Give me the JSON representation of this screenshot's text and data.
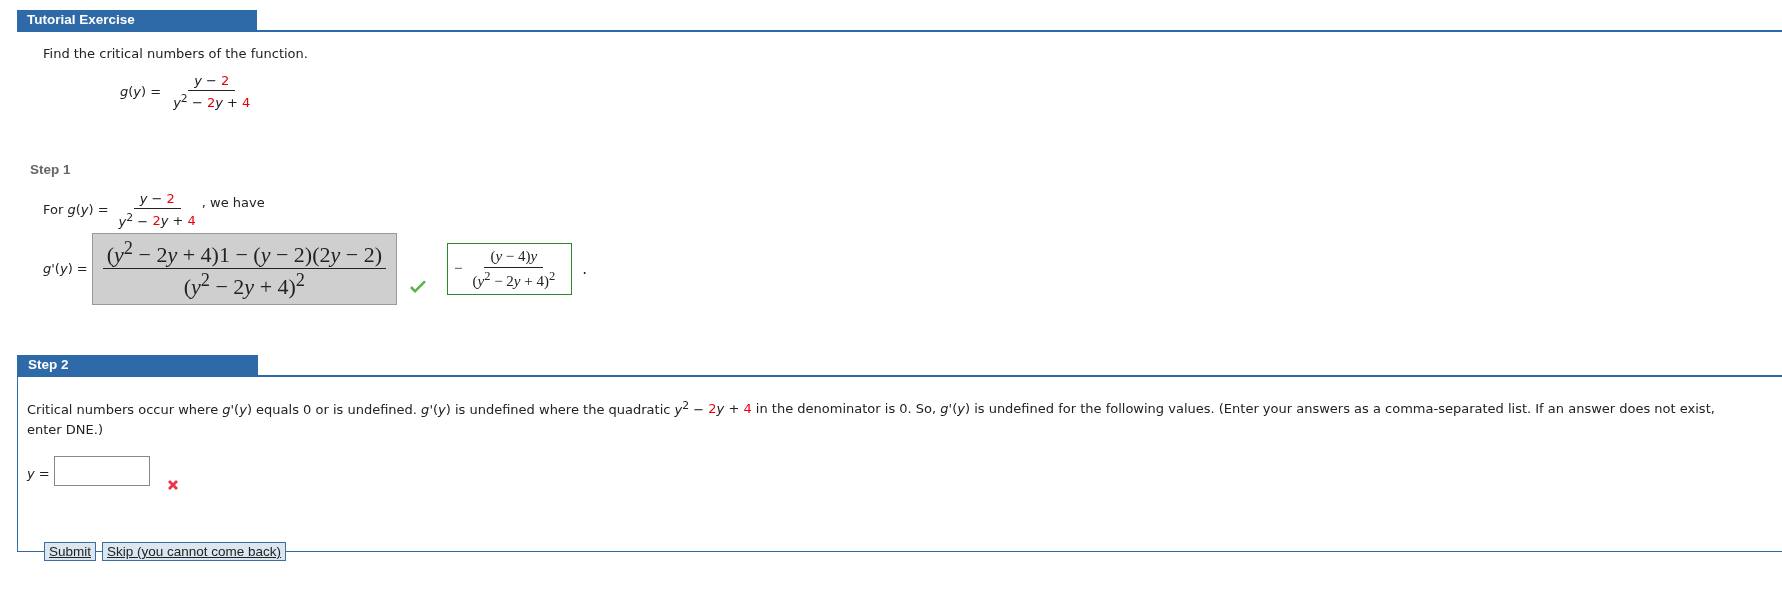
{
  "header": {
    "title": "Tutorial Exercise"
  },
  "problem": {
    "prompt": "Find the critical numbers of the function.",
    "function": {
      "lhs": "*g*(*y*) =",
      "numerator": [
        {
          "text": "*y* − ",
          "red": false
        },
        {
          "text": "2",
          "red": true
        }
      ],
      "denominator": [
        {
          "text": "*y*$^{2}$ − ",
          "red": false
        },
        {
          "text": "2",
          "red": true
        },
        {
          "text": "*y* + ",
          "red": false
        },
        {
          "text": "4",
          "red": true
        }
      ]
    }
  },
  "step1": {
    "label": "Step 1",
    "intro": {
      "before": "For *g*(*y*) =",
      "after": ", we have",
      "numerator": [
        {
          "text": "*y* − ",
          "red": false
        },
        {
          "text": "2",
          "red": true
        }
      ],
      "denominator": [
        {
          "text": "*y*$^{2}$ − ",
          "red": false
        },
        {
          "text": "2",
          "red": true
        },
        {
          "text": "*y* + ",
          "red": false
        },
        {
          "text": "4",
          "red": true
        }
      ]
    },
    "lhs": "*g*'(*y*) =",
    "answer": {
      "numerator": [
        "(*y*$^{2}$ − 2",
        "*y*",
        " + 4)1 − (*y* − 2)(2",
        "*y*",
        " − 2)"
      ],
      "denominator": [
        "(*y*$^{2}$ − 2",
        "*y*",
        " + 4)$^{2}$"
      ],
      "correct": true
    },
    "solution": {
      "sign": "−",
      "numerator": [
        "(*y* − 4)",
        "*y*"
      ],
      "denominator": [
        "(*y*$^{2}$ − 2",
        "*y*",
        " + 4)$^{2}$"
      ]
    },
    "end": "."
  },
  "step2": {
    "label": "Step 2",
    "text": [
      {
        "text": "Critical numbers occur where *g*'(*y*) equals 0 or is undefined. *g*'(*y*) is undefined where the quadratic *y*$^{2}$ − ",
        "red": false
      },
      {
        "text": "2",
        "red": true
      },
      {
        "text": "*y* + ",
        "red": false
      },
      {
        "text": "4",
        "red": true
      },
      {
        "text": " in the denominator is 0. So, *g*'(*y*) is undefined for the following values. (Enter your answers as a comma-separated list. If an answer does not exist, enter DNE.)",
        "red": false
      }
    ],
    "field_label": "*y* =",
    "field": {
      "correct": false
    },
    "buttons": [
      "Submit",
      "Skip (you cannot come back)"
    ]
  }
}
